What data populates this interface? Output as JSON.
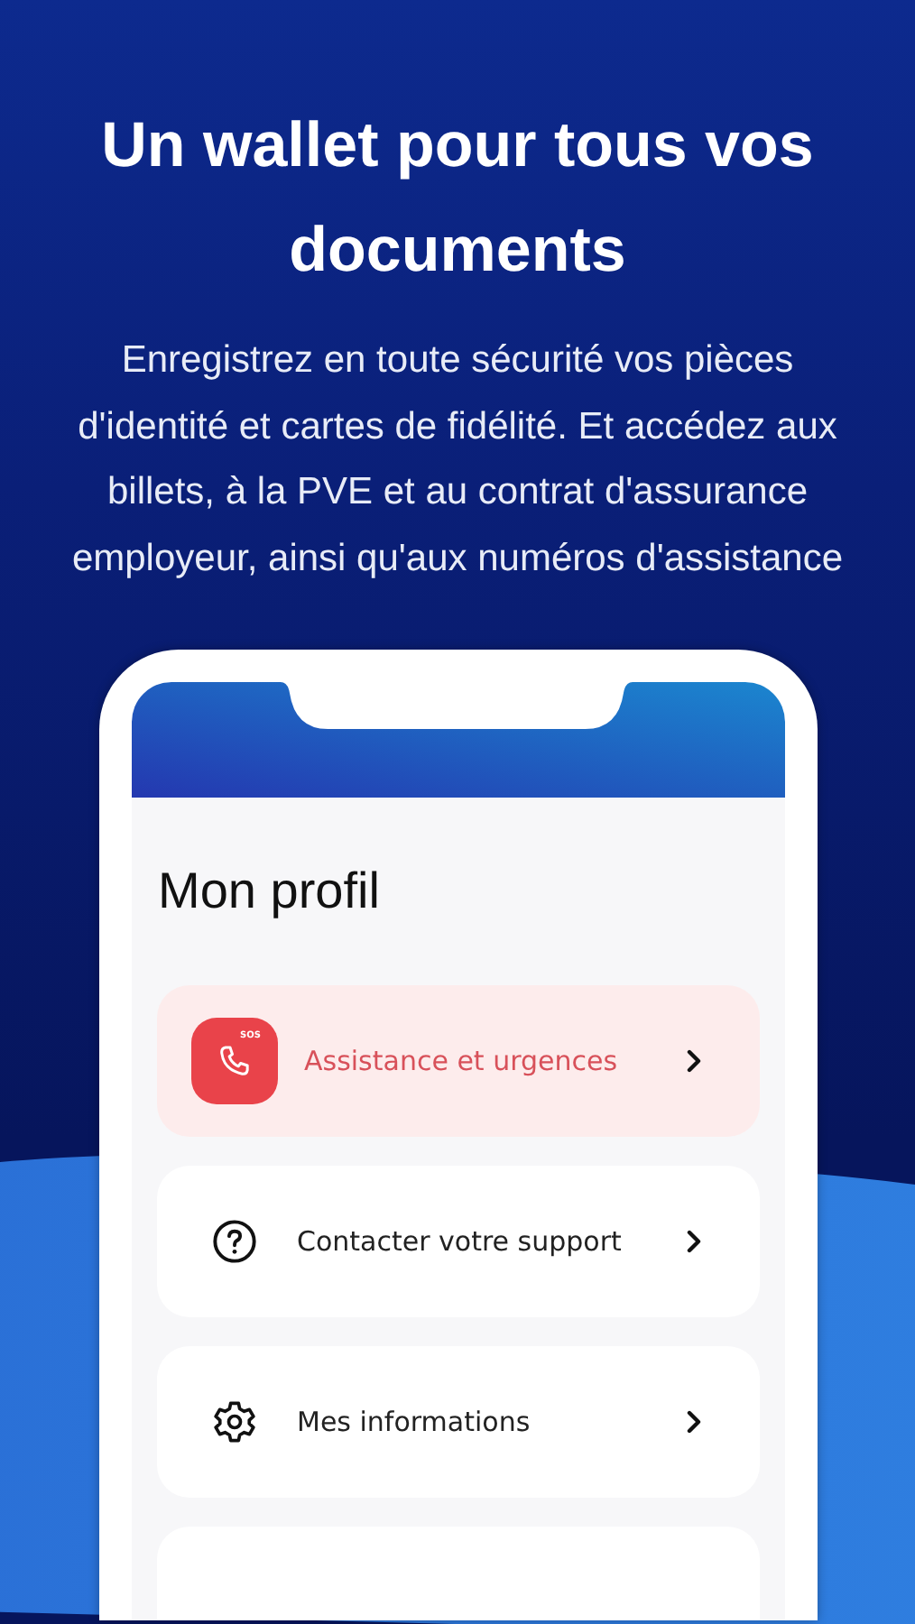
{
  "headline": "Un wallet pour tous vos documents",
  "description": "Enregistrez en toute sécurité vos pièces d'identité et cartes de fidélité. Et accédez aux billets, à la PVE et au contrat d'assurance employeur, ainsi qu'aux numéros d'assistance",
  "phone": {
    "page_title": "Mon profil",
    "menu_items": [
      {
        "kind": "emergency",
        "label": "Assistance et urgences",
        "icon_text": "SOS"
      },
      {
        "kind": "help",
        "label": "Contacter votre support"
      },
      {
        "kind": "settings",
        "label": "Mes informations"
      }
    ]
  }
}
